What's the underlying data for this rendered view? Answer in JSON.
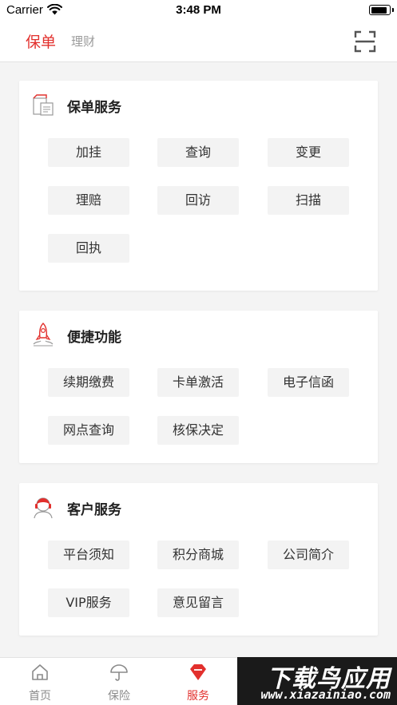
{
  "status_bar": {
    "carrier": "Carrier",
    "time": "3:48 PM",
    "battery_level": 0.92
  },
  "header": {
    "tabs": [
      {
        "label": "保单",
        "active": true
      },
      {
        "label": "理财",
        "active": false
      }
    ],
    "scan_icon": "scan-frame-icon"
  },
  "sections": [
    {
      "title": "保单服务",
      "icon": "policy-document-icon",
      "buttons": [
        "加挂",
        "查询",
        "变更",
        "理赔",
        "回访",
        "扫描",
        "回执"
      ]
    },
    {
      "title": "便捷功能",
      "icon": "rocket-icon",
      "buttons": [
        "续期缴费",
        "卡单激活",
        "电子信函",
        "网点查询",
        "核保决定"
      ]
    },
    {
      "title": "客户服务",
      "icon": "customer-service-agent-icon",
      "buttons": [
        "平台须知",
        "积分商城",
        "公司简介",
        "VIP服务",
        "意见留言"
      ]
    }
  ],
  "bottom_nav": [
    {
      "label": "首页",
      "icon": "home-icon",
      "active": false
    },
    {
      "label": "保险",
      "icon": "umbrella-icon",
      "active": false
    },
    {
      "label": "服务",
      "icon": "service-gem-icon",
      "active": true
    }
  ],
  "watermark": {
    "title": "下载鸟应用",
    "url": "www.xiazainiao.com"
  },
  "colors": {
    "accent": "#e2302d",
    "inactive_text": "#8a8a8a",
    "button_bg": "#f3f3f3",
    "page_bg": "#f4f4f4"
  }
}
